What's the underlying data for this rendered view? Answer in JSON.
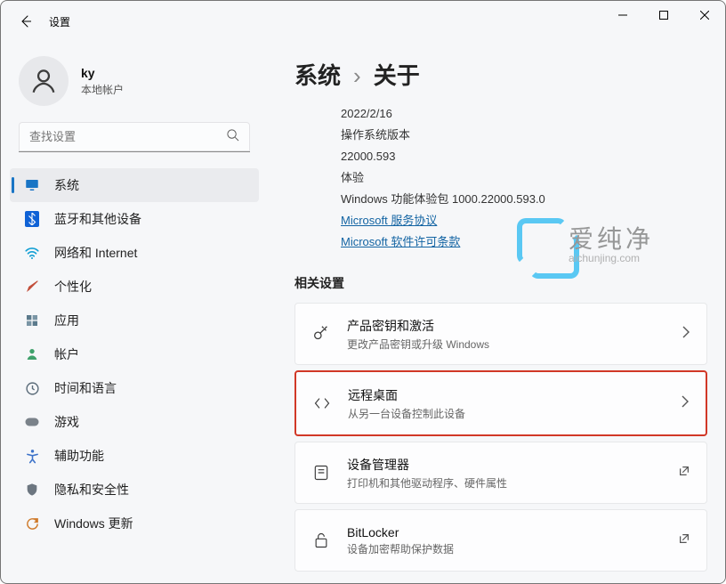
{
  "app_title": "设置",
  "user": {
    "name": "ky",
    "sub": "本地帐户"
  },
  "search": {
    "placeholder": "查找设置"
  },
  "nav": [
    {
      "key": "system",
      "label": "系统",
      "icon": "monitor",
      "color": "#1975c5",
      "sel": true
    },
    {
      "key": "bluetooth",
      "label": "蓝牙和其他设备",
      "icon": "bluetooth",
      "color": "#0f62d6"
    },
    {
      "key": "network",
      "label": "网络和 Internet",
      "icon": "wifi",
      "color": "#14a0d4"
    },
    {
      "key": "personalization",
      "label": "个性化",
      "icon": "brush",
      "color": "#c24f3b"
    },
    {
      "key": "apps",
      "label": "应用",
      "icon": "apps",
      "color": "#5b7a8c"
    },
    {
      "key": "accounts",
      "label": "帐户",
      "icon": "person",
      "color": "#3fa16b"
    },
    {
      "key": "time",
      "label": "时间和语言",
      "icon": "clock",
      "color": "#5b6c7a"
    },
    {
      "key": "gaming",
      "label": "游戏",
      "icon": "gamepad",
      "color": "#7a828a"
    },
    {
      "key": "accessibility",
      "label": "辅助功能",
      "icon": "accessibility",
      "color": "#3c72c9"
    },
    {
      "key": "privacy",
      "label": "隐私和安全性",
      "icon": "shield",
      "color": "#6c7680"
    },
    {
      "key": "update",
      "label": "Windows 更新",
      "icon": "update",
      "color": "#cf7a2a"
    }
  ],
  "breadcrumb": {
    "root": "系统",
    "leaf": "关于"
  },
  "about": {
    "date": "2022/2/16",
    "os_version_label": "操作系统版本",
    "os_version": "22000.593",
    "experience_label": "体验",
    "experience_value": "Windows 功能体验包 1000.22000.593.0",
    "link_service": "Microsoft 服务协议",
    "link_license": "Microsoft 软件许可条款"
  },
  "related_title": "相关设置",
  "cards": [
    {
      "title": "产品密钥和激活",
      "sub": "更改产品密钥或升级 Windows",
      "icon": "key",
      "action": "chevron"
    },
    {
      "title": "远程桌面",
      "sub": "从另一台设备控制此设备",
      "icon": "remote",
      "action": "chevron",
      "highlight": true
    },
    {
      "title": "设备管理器",
      "sub": "打印机和其他驱动程序、硬件属性",
      "icon": "device",
      "action": "external"
    },
    {
      "title": "BitLocker",
      "sub": "设备加密帮助保护数据",
      "icon": "lock",
      "action": "external"
    }
  ],
  "watermark": {
    "big": "爱纯净",
    "small": "aichunjing.com"
  }
}
